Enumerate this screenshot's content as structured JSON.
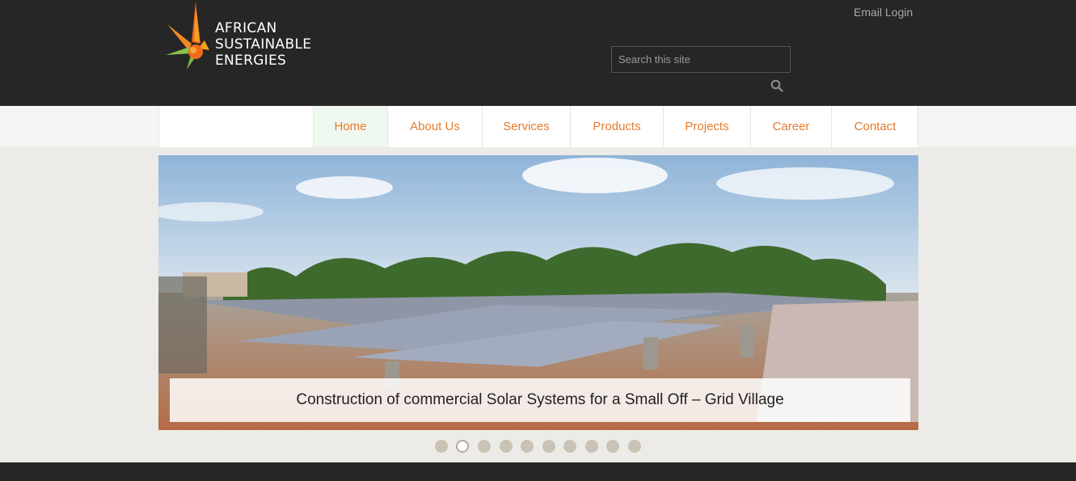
{
  "site": {
    "logo_lines": [
      "AFRICAN",
      "SUSTAINABLE",
      "ENERGIES"
    ],
    "email_login": "Email Login",
    "search_placeholder": "Search this site"
  },
  "nav": {
    "items": [
      {
        "label": "Home",
        "active": true
      },
      {
        "label": "About Us",
        "active": false
      },
      {
        "label": "Services",
        "active": false
      },
      {
        "label": "Products",
        "active": false
      },
      {
        "label": "Projects",
        "active": false
      },
      {
        "label": "Career",
        "active": false
      },
      {
        "label": "Contact",
        "active": false
      }
    ]
  },
  "slider": {
    "caption": "Construction of commercial Solar Systems for a Small Off – Grid Village",
    "slide_count": 10,
    "active_index": 1
  },
  "colors": {
    "header_bg": "#262626",
    "nav_text": "#e57a2c",
    "nav_active_bg": "#eff8ee"
  },
  "icons": {
    "search": "search-icon",
    "logo": "sunburst-logo-icon"
  }
}
